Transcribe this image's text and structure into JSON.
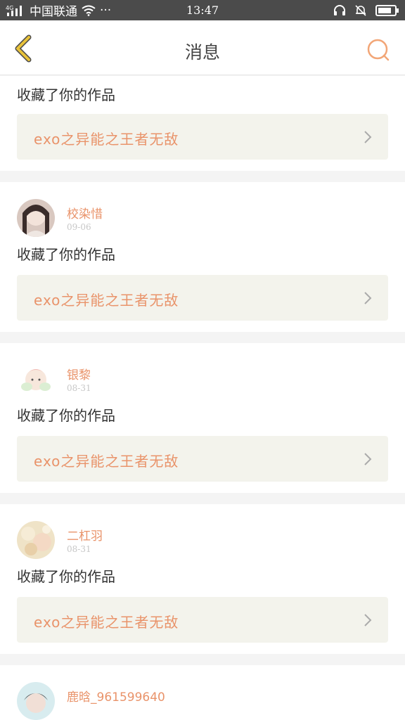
{
  "status_bar": {
    "signal": "4G",
    "carrier": "中国联通",
    "more": "···",
    "time": "13:47"
  },
  "nav": {
    "title": "消息",
    "back_icon": "chevron-left-icon",
    "search_icon": "search-icon"
  },
  "colors": {
    "accent": "#e9936a",
    "back": "#e8c23a",
    "card_bg": "#f3f3ec"
  },
  "messages": [
    {
      "user": "",
      "date": "",
      "action": "收藏了你的作品",
      "work": "exo之异能之王者无敌"
    },
    {
      "user": "校染惜",
      "date": "09-06",
      "action": "收藏了你的作品",
      "work": "exo之异能之王者无敌"
    },
    {
      "user": "银黎",
      "date": "08-31",
      "action": "收藏了你的作品",
      "work": "exo之异能之王者无敌"
    },
    {
      "user": "二杠羽",
      "date": "08-31",
      "action": "收藏了你的作品",
      "work": "exo之异能之王者无敌"
    },
    {
      "user": "鹿晗_961599640",
      "date": "",
      "action": "",
      "work": ""
    }
  ]
}
